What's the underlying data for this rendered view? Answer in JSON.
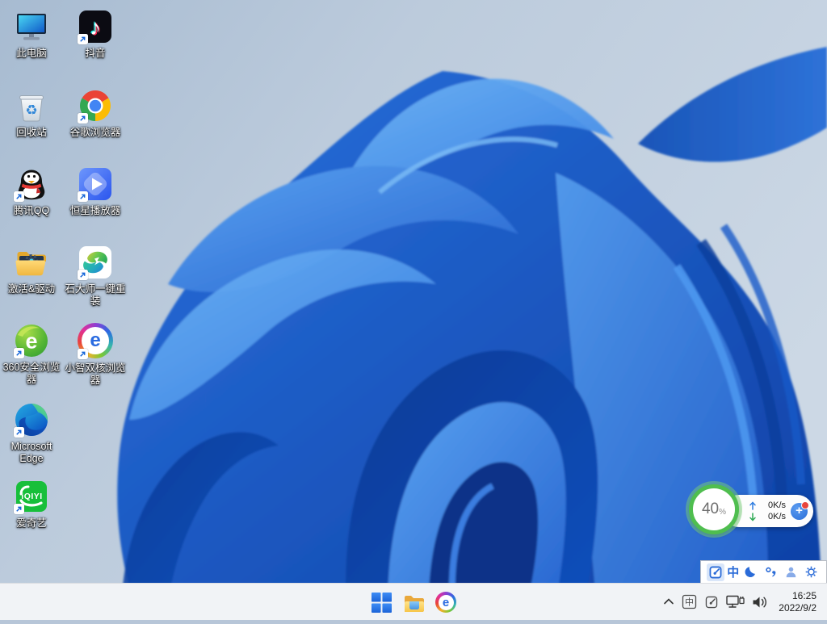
{
  "wallpaper": {
    "name": "windows-11-bloom"
  },
  "desktop": {
    "icons": [
      {
        "id": "this-pc",
        "label": "此电脑",
        "shortcut": false
      },
      {
        "id": "douyin",
        "label": "抖音",
        "shortcut": true
      },
      {
        "id": "recycle-bin",
        "label": "回收站",
        "shortcut": false
      },
      {
        "id": "chrome",
        "label": "谷歌浏览器",
        "shortcut": true
      },
      {
        "id": "tencent-qq",
        "label": "腾讯QQ",
        "shortcut": true
      },
      {
        "id": "stellar-player",
        "label": "恒星播放器",
        "shortcut": true
      },
      {
        "id": "activate-driver",
        "label": "激活&驱动",
        "shortcut": false
      },
      {
        "id": "shidashi",
        "label": "石大师一键重装",
        "shortcut": true
      },
      {
        "id": "360-browser",
        "label": "360安全浏览器",
        "shortcut": true
      },
      {
        "id": "xiaozhi-browser",
        "label": "小智双核浏览器",
        "shortcut": true
      },
      {
        "id": "microsoft-edge",
        "label": "Microsoft Edge",
        "shortcut": true
      },
      {
        "id": "iqiyi",
        "label": "爱奇艺",
        "shortcut": true
      }
    ]
  },
  "glyphs": {
    "e": "e",
    "iqiyi": "iQIYI",
    "recycle": "♻",
    "note": "♪",
    "plus": "+"
  },
  "net_widget": {
    "percent": "40",
    "unit": "%",
    "up_speed": "0K/s",
    "down_speed": "0K/s",
    "accent_green": "#4fbe4f",
    "up_arrow_color": "#2f7de0",
    "down_arrow_color": "#2faa55"
  },
  "ime_toolbar": {
    "mode": "中",
    "accent_blue": "#2a6bd8"
  },
  "taskbar": {
    "tray_ime": "中",
    "clock": {
      "time": "16:25",
      "date": "2022/9/2"
    }
  }
}
